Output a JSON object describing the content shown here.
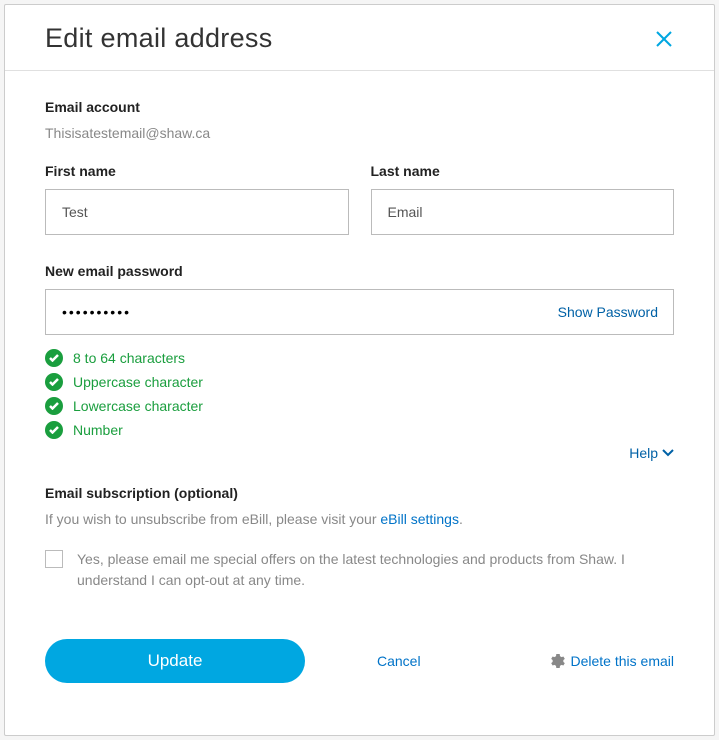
{
  "header": {
    "title": "Edit email address"
  },
  "account": {
    "label": "Email account",
    "email": "Thisisatestemail@shaw.ca"
  },
  "firstName": {
    "label": "First name",
    "value": "Test"
  },
  "lastName": {
    "label": "Last name",
    "value": "Email"
  },
  "password": {
    "label": "New email password",
    "value": "••••••••••",
    "show": "Show Password"
  },
  "checks": {
    "c1": "8 to 64 characters",
    "c2": "Uppercase character",
    "c3": "Lowercase character",
    "c4": "Number"
  },
  "help": "Help",
  "subscription": {
    "label": "Email subscription (optional)",
    "ebillPre": "If you wish to unsubscribe from eBill, please visit your ",
    "ebillLink": "eBill settings",
    "ebillPost": ".",
    "optin": "Yes, please email me special offers on the latest technologies and products from Shaw. I understand I can opt-out at any time."
  },
  "actions": {
    "update": "Update",
    "cancel": "Cancel",
    "delete": "Delete this email"
  }
}
